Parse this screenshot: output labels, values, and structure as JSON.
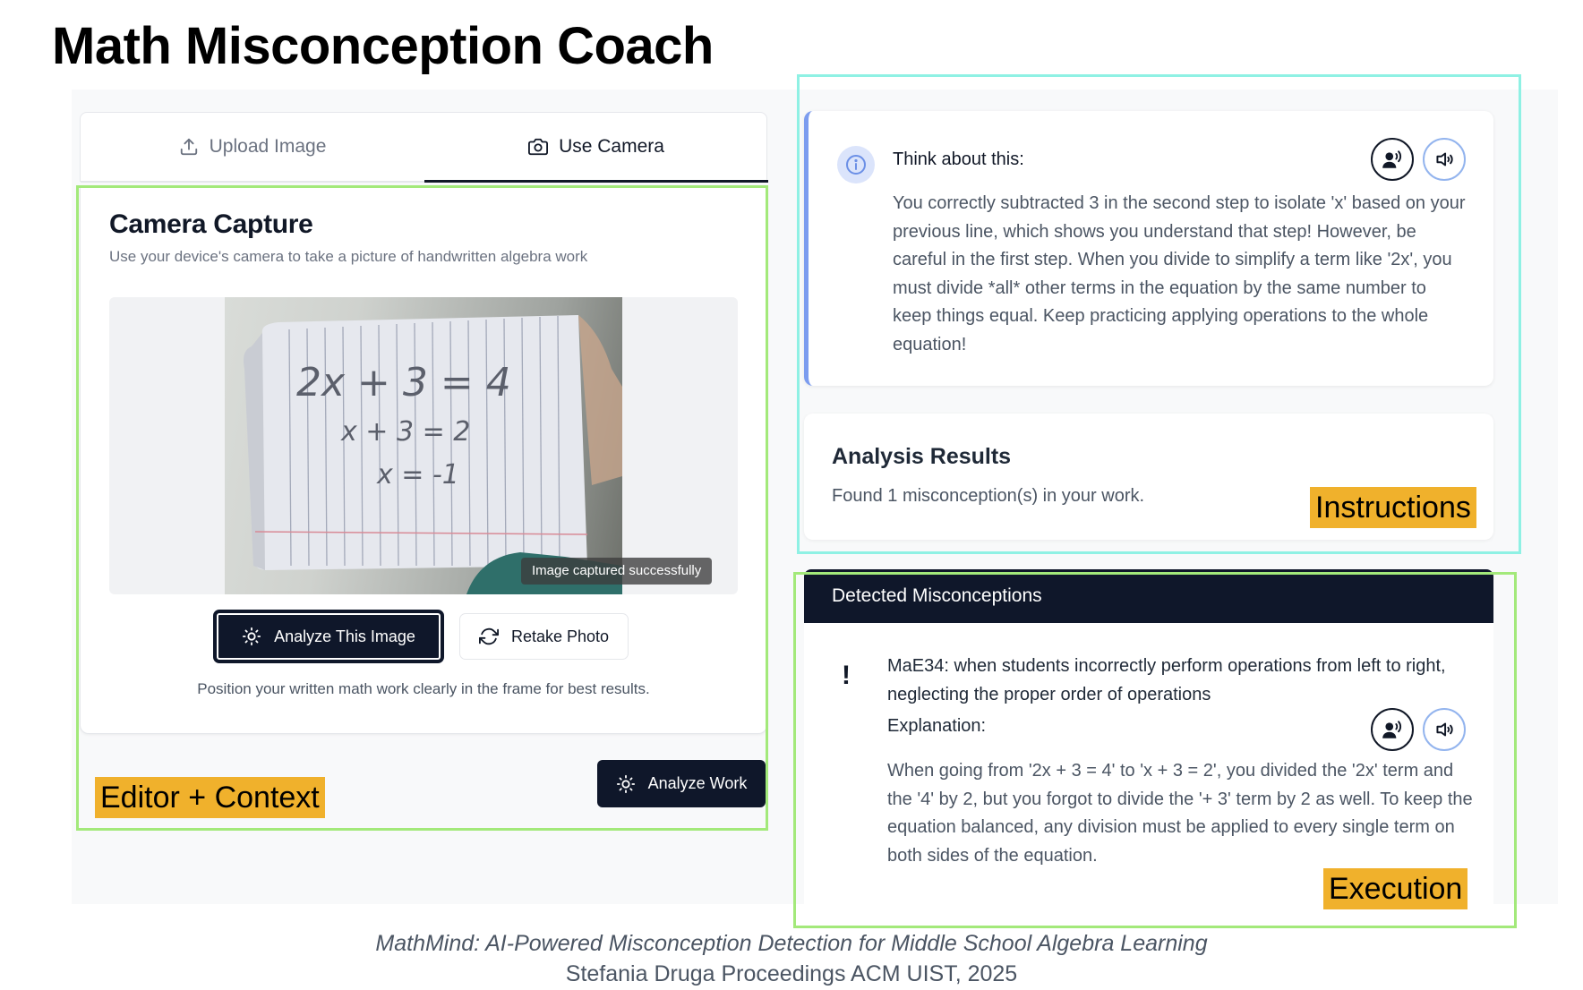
{
  "page": {
    "title": "Math Misconception Coach"
  },
  "tabs": [
    {
      "label": "Upload Image",
      "icon": "upload-icon",
      "active": false
    },
    {
      "label": "Use Camera",
      "icon": "camera-icon",
      "active": true
    }
  ],
  "camera": {
    "title": "Camera Capture",
    "subtitle": "Use your device's camera to take a picture of handwritten algebra work",
    "photo_lines": [
      "2x + 3 = 4",
      "x + 3 = 2",
      "x = -1"
    ],
    "toast": "Image captured successfully",
    "analyze_button": "Analyze This Image",
    "retake_button": "Retake Photo",
    "hint": "Position your written math work clearly in the frame for best results."
  },
  "analyze_work_button": "Analyze Work",
  "feedback": {
    "title": "Think about this:",
    "body": "You correctly subtracted 3 in the second step to isolate 'x' based on your previous line, which shows you understand that step! However, be careful in the first step. When you divide to simplify a term like '2x', you must divide *all* other terms in the equation by the same number to keep things equal. Keep practicing applying operations to the whole equation!"
  },
  "analysis": {
    "title": "Analysis Results",
    "summary": "Found 1 misconception(s) in your work."
  },
  "misconceptions": {
    "header": "Detected Misconceptions",
    "items": [
      {
        "title": "MaE34: when students incorrectly perform operations from left to right, neglecting the proper order of operations",
        "explanation_label": "Explanation:",
        "explanation": "When going from '2x + 3 = 4' to 'x + 3 = 2', you divided the '2x' term and the '4' by 2, but you forgot to divide the '+ 3' term by 2 as well. To keep the equation balanced, any division must be applied to every single term on both sides of the equation."
      }
    ]
  },
  "annotations": {
    "editor": "Editor + Context",
    "instructions": "Instructions",
    "execution": "Execution"
  },
  "citation": {
    "title": "MathMind: AI-Powered Misconception Detection for Middle School Algebra Learning",
    "authors": "Stefania Druga  Proceedings ACM UIST, 2025"
  },
  "colors": {
    "dark_navy": "#0f172a",
    "accent_blue": "#7c9cef",
    "frame_green": "#a3e97a",
    "frame_cyan": "#8ff1e4",
    "tag_orange": "#f0b12c"
  }
}
